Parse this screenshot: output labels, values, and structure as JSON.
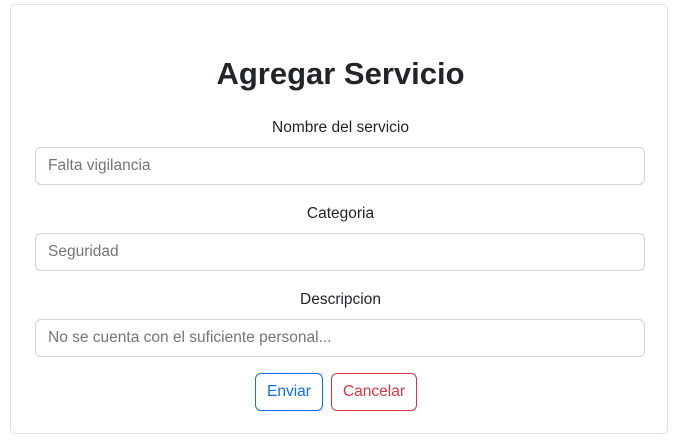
{
  "form": {
    "title": "Agregar Servicio",
    "fields": [
      {
        "label": "Nombre del servicio",
        "placeholder": "Falta vigilancia",
        "value": ""
      },
      {
        "label": "Categoria",
        "placeholder": "Seguridad",
        "value": ""
      },
      {
        "label": "Descripcion",
        "placeholder": "No se cuenta con el suficiente personal...",
        "value": ""
      }
    ],
    "submit_label": "Enviar",
    "cancel_label": "Cancelar"
  },
  "colors": {
    "primary": "#0d6efd",
    "danger": "#dc3545",
    "border": "#ced4da",
    "text": "#212529"
  }
}
